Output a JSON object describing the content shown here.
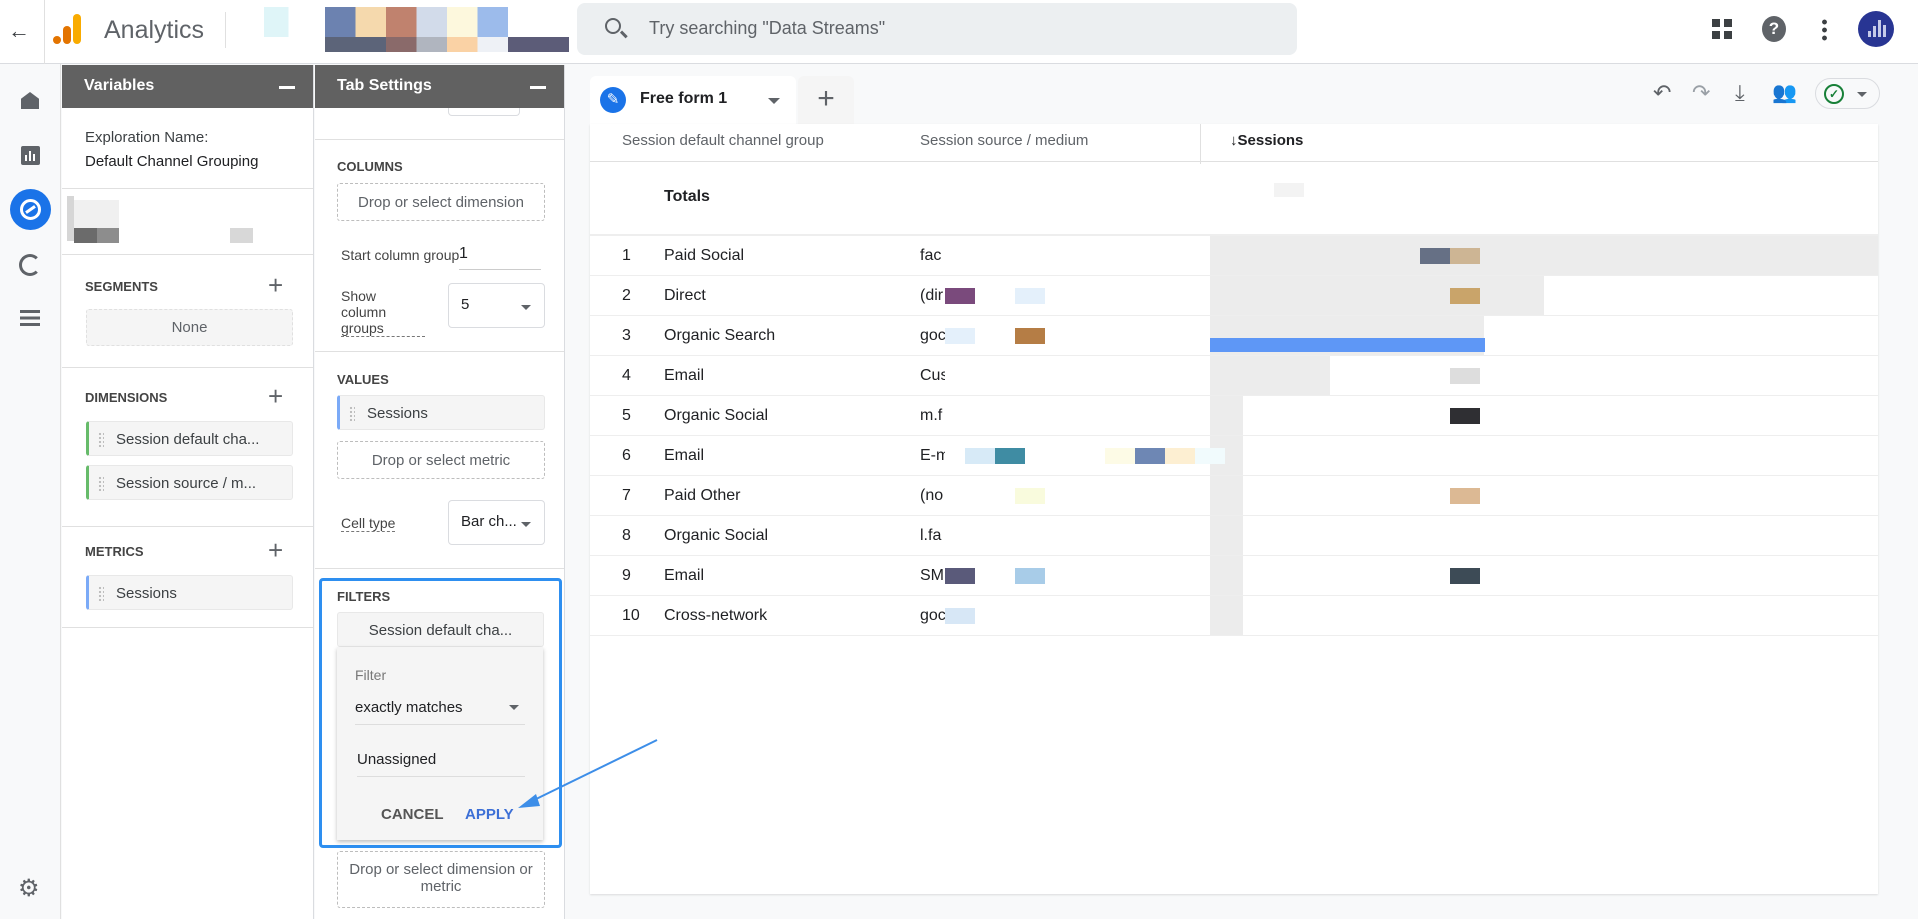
{
  "app": {
    "title": "Analytics",
    "search_placeholder": "Try searching \"Data Streams\""
  },
  "icons": {
    "back": "arrow-left-icon",
    "apps": "apps-grid-icon",
    "help": "help-icon",
    "more": "more-vert-icon",
    "avatar": "account-avatar-icon"
  },
  "rail": [
    "home",
    "reports",
    "explore",
    "advertising",
    "configure",
    "settings"
  ],
  "variables": {
    "title": "Variables",
    "exploration_label": "Exploration Name:",
    "exploration_name": "Default Channel Grouping",
    "segments_label": "SEGMENTS",
    "segments_value": "None",
    "dimensions_label": "DIMENSIONS",
    "dimensions": [
      "Session default cha...",
      "Session source / m..."
    ],
    "metrics_label": "METRICS",
    "metrics": [
      "Sessions"
    ]
  },
  "tab_settings": {
    "title": "Tab Settings",
    "columns_label": "COLUMNS",
    "columns_drop": "Drop or select dimension",
    "start_column_group_label": "Start column group",
    "start_column_group_value": "1",
    "show_column_groups_label": "Show column groups",
    "show_column_groups_value": "5",
    "values_label": "VALUES",
    "values": [
      "Sessions"
    ],
    "values_drop": "Drop or select metric",
    "cell_type_label": "Cell type",
    "cell_type_value": "Bar ch...",
    "filters_label": "FILTERS",
    "filter_chip": "Session default cha...",
    "filter_popup": {
      "label": "Filter",
      "match_type": "exactly matches",
      "value": "Unassigned",
      "cancel": "CANCEL",
      "apply": "APPLY"
    },
    "filters_drop": "Drop or select dimension or metric"
  },
  "tabs": [
    {
      "label": "Free form 1"
    }
  ],
  "add_tab": "+",
  "toolbar": [
    "undo-icon",
    "redo-icon",
    "download-icon",
    "share-icon",
    "check-circle-icon"
  ],
  "colors": {
    "accent": "#1a73e8",
    "header": "#616161",
    "dimension": "#66bb6a",
    "metric": "#7baaf7",
    "check": "#188038"
  },
  "table": {
    "columns": [
      "Session default channel group",
      "Session source / medium",
      "↓Sessions"
    ],
    "totals_label": "Totals",
    "rows": [
      {
        "n": "1",
        "channel": "Paid Social",
        "source": "fac",
        "bar": 1.0
      },
      {
        "n": "2",
        "channel": "Direct",
        "source": "(dir",
        "bar": 0.5
      },
      {
        "n": "3",
        "channel": "Organic Search",
        "source": "goc",
        "bar": 0.41
      },
      {
        "n": "4",
        "channel": "Email",
        "source": "Cus",
        "bar": 0.18
      },
      {
        "n": "5",
        "channel": "Organic Social",
        "source": "m.f",
        "bar": 0.05
      },
      {
        "n": "6",
        "channel": "Email",
        "source": "E-m",
        "bar": 0.05
      },
      {
        "n": "7",
        "channel": "Paid Other",
        "source": "(no",
        "bar": 0.05
      },
      {
        "n": "8",
        "channel": "Organic Social",
        "source": "l.fa",
        "bar": 0.05
      },
      {
        "n": "9",
        "channel": "Email",
        "source": "SM",
        "bar": 0.05
      },
      {
        "n": "10",
        "channel": "Cross-network",
        "source": "goc",
        "bar": 0.05
      }
    ]
  }
}
